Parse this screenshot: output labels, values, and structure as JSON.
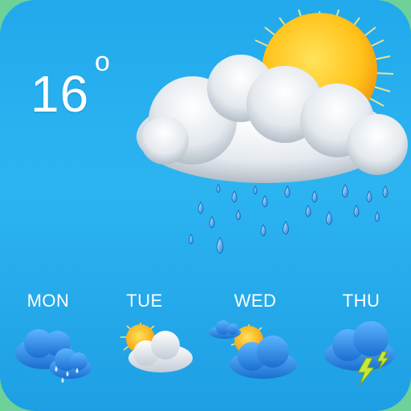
{
  "current": {
    "temperature": "16",
    "degree_symbol": "o",
    "icon": "sun-cloud-rain-icon"
  },
  "forecast": [
    {
      "day": "MON",
      "icon": "rain-cloud-icon"
    },
    {
      "day": "TUE",
      "icon": "partly-sunny-icon"
    },
    {
      "day": "WED",
      "icon": "partly-cloudy-icon"
    },
    {
      "day": "THU",
      "icon": "thunderstorm-icon"
    }
  ],
  "colors": {
    "background": "#21a9ec",
    "text": "#ffffff",
    "sun": "#ffc21a",
    "cloud": "#e9eef2",
    "forecast_cloud": "#2b8fe6",
    "lightning": "#c6e83a"
  }
}
